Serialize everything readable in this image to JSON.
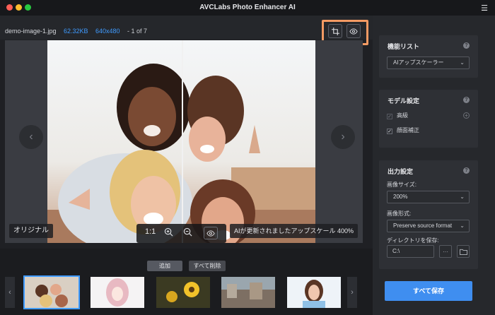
{
  "app": {
    "title": "AVCLabs Photo Enhancer AI"
  },
  "file": {
    "name": "demo-image-1.jpg",
    "size": "62.32KB",
    "dimensions": "640x480",
    "counter": "- 1 of 7"
  },
  "preview": {
    "original_label": "オリジナル",
    "zoom_fit_label": "1:1",
    "status_text": "AIが更新されましたアップスケール 400%"
  },
  "actions": {
    "add_label": "追加",
    "clear_label": "すべて削除",
    "save_all_label": "すべて保存"
  },
  "feature_list": {
    "title": "機能リスト",
    "selected": "AIアップスケーラー"
  },
  "model_settings": {
    "title": "モデル設定",
    "options": [
      {
        "label": "高級",
        "checked": false
      },
      {
        "label": "顔面補正",
        "checked": true
      }
    ]
  },
  "output_settings": {
    "title": "出力設定",
    "image_size_label": "画像サイズ:",
    "image_size_value": "200%",
    "format_label": "画像形式:",
    "format_value": "Preserve source format",
    "directory_label": "ディレクトリを保存:",
    "directory_value": "C:\\",
    "more_label": "···"
  },
  "colors": {
    "accent": "#3f9bff",
    "highlight": "#f39a63",
    "save_button": "#3f8ef0"
  },
  "icons": [
    "crop-icon",
    "eye-icon",
    "zoom-in-icon",
    "zoom-out-icon",
    "compare-eye-icon",
    "chevron-left-icon",
    "chevron-right-icon",
    "help-icon",
    "plus-circle-icon",
    "folder-icon",
    "menu-icon"
  ]
}
